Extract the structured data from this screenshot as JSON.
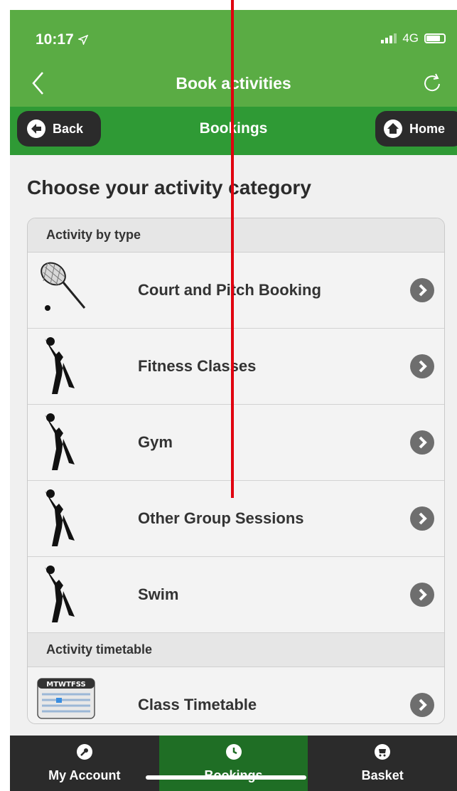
{
  "status_bar": {
    "time": "10:17",
    "network": "4G"
  },
  "app_header": {
    "title": "Book activities"
  },
  "sub_nav": {
    "back_label": "Back",
    "title": "Bookings",
    "home_label": "Home"
  },
  "page": {
    "heading": "Choose your activity category"
  },
  "sections": [
    {
      "header": "Activity by type",
      "items": [
        {
          "label": "Court and Pitch Booking",
          "icon": "tennis-racket-icon"
        },
        {
          "label": "Fitness Classes",
          "icon": "stretching-person-icon"
        },
        {
          "label": "Gym",
          "icon": "stretching-person-icon"
        },
        {
          "label": "Other Group Sessions",
          "icon": "stretching-person-icon"
        },
        {
          "label": "Swim",
          "icon": "stretching-person-icon"
        }
      ]
    },
    {
      "header": "Activity timetable",
      "items": [
        {
          "label": "Class Timetable",
          "icon": "calendar-icon",
          "calendar_header": "MTWTFSS"
        }
      ]
    }
  ],
  "tab_bar": {
    "tabs": [
      {
        "label": "My Account",
        "icon": "key-icon",
        "active": false
      },
      {
        "label": "Bookings",
        "icon": "clock-icon",
        "active": true
      },
      {
        "label": "Basket",
        "icon": "cart-icon",
        "active": false
      }
    ]
  },
  "colors": {
    "header_green": "#5aac44",
    "subnav_green": "#2f9a35",
    "active_tab": "#1f6e25",
    "annotation_line": "#e0000f"
  }
}
